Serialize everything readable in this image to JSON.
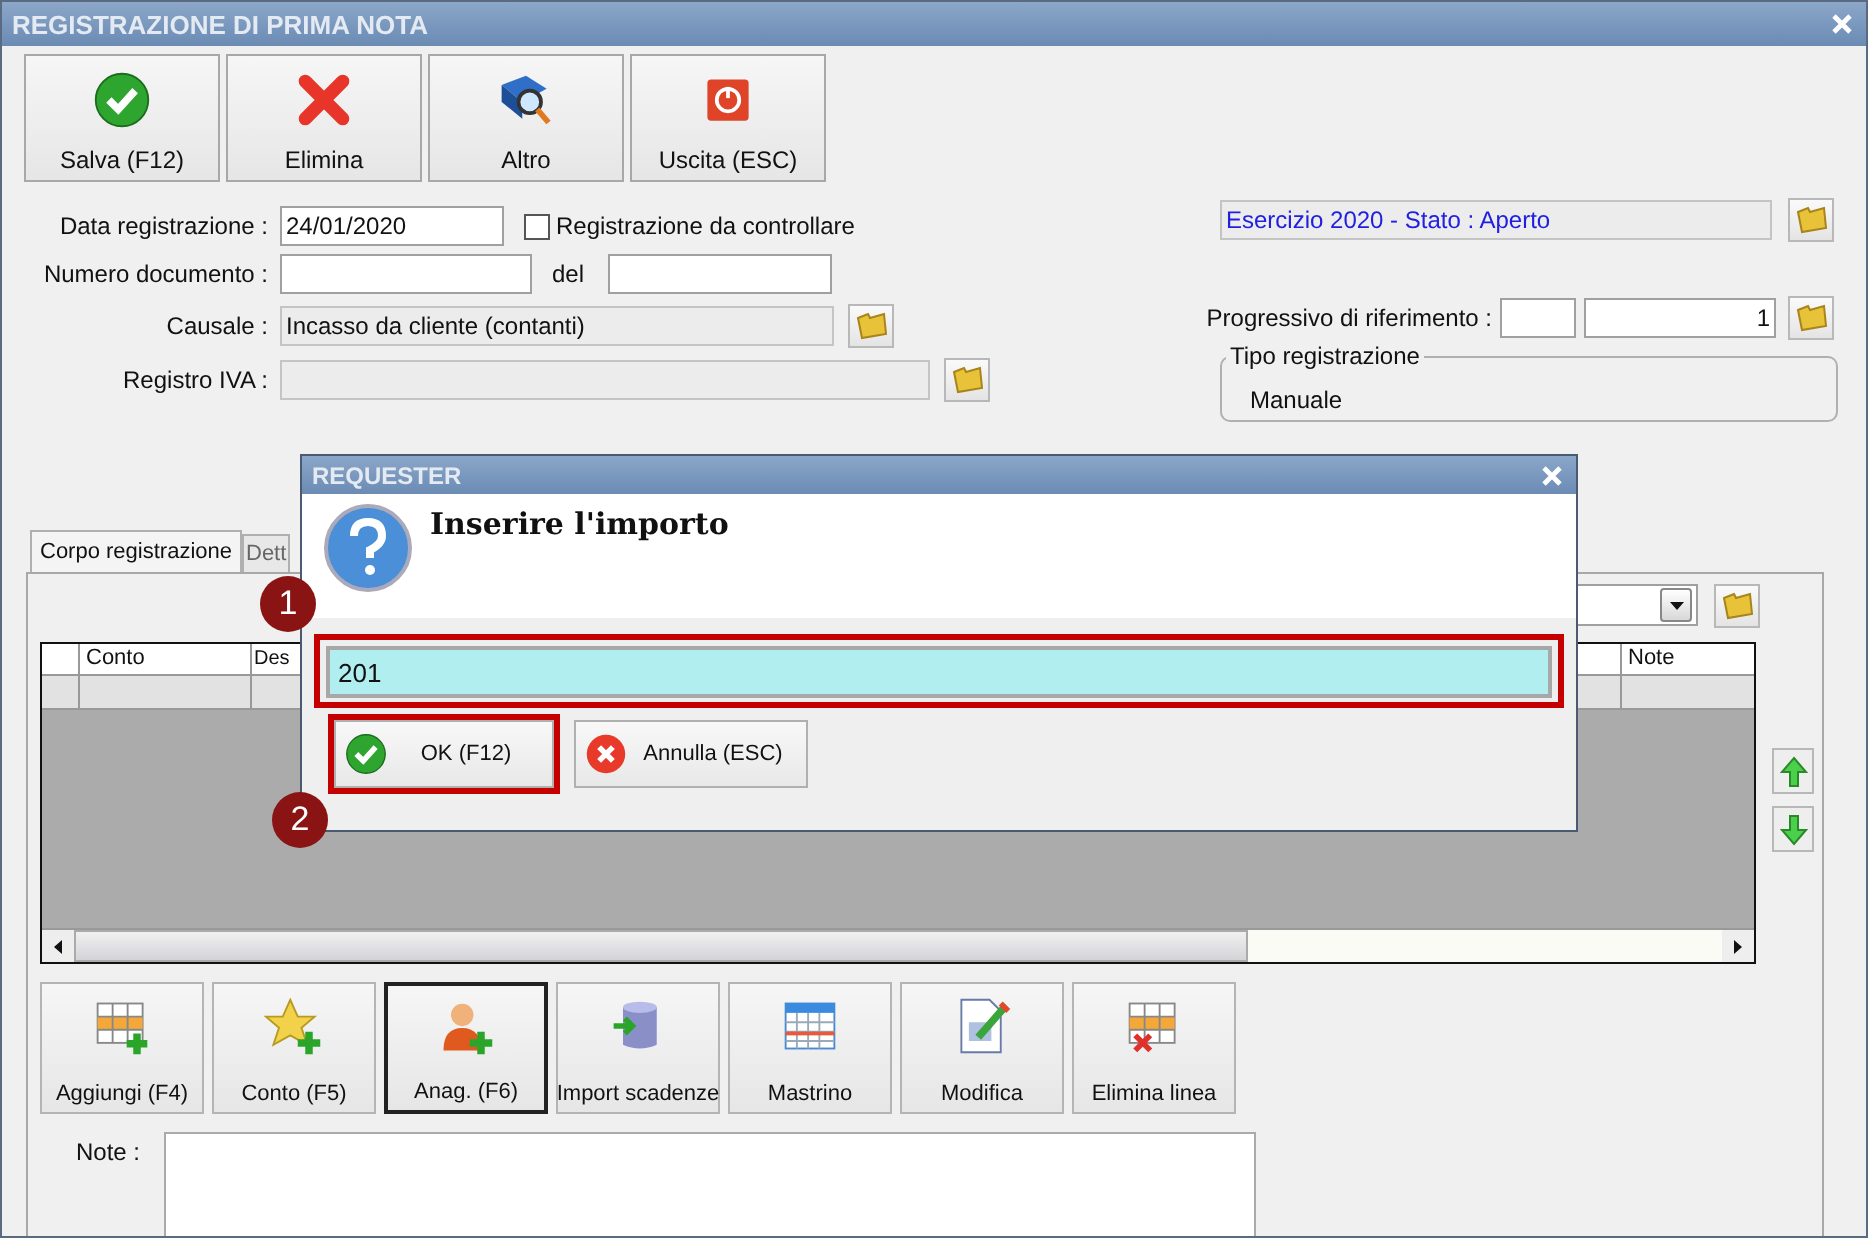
{
  "window": {
    "title": "REGISTRAZIONE DI PRIMA NOTA"
  },
  "toolbar": [
    {
      "label": "Salva (F12)",
      "kind": "check"
    },
    {
      "label": "Elimina",
      "kind": "cross"
    },
    {
      "label": "Altro",
      "kind": "search-book"
    },
    {
      "label": "Uscita (ESC)",
      "kind": "power"
    }
  ],
  "form": {
    "data_registrazione": {
      "label": "Data registrazione :",
      "value": "24/01/2020"
    },
    "da_controllare": {
      "label": "Registrazione da controllare",
      "checked": false
    },
    "numero_documento": {
      "label": "Numero documento :"
    },
    "del": {
      "label": "del"
    },
    "causale": {
      "label": "Causale :",
      "value": "Incasso da cliente (contanti)"
    },
    "registro_iva": {
      "label": "Registro IVA :"
    }
  },
  "esercizio": {
    "value": "Esercizio 2020 - Stato : Aperto"
  },
  "progressivo": {
    "label": "Progressivo di riferimento :",
    "value": "1"
  },
  "tipo_registrazione": {
    "legend": "Tipo registrazione",
    "value": "Manuale"
  },
  "tabs": [
    {
      "label": "Corpo registrazione",
      "selected": true
    },
    {
      "label": "Dett",
      "selected": false
    }
  ],
  "table": {
    "columns": [
      "Conto",
      "Des",
      "Note"
    ]
  },
  "actions": [
    {
      "label": "Aggiungi (F4)",
      "kind": "grid-add",
      "selected": false
    },
    {
      "label": "Conto (F5)",
      "kind": "star-add",
      "selected": false
    },
    {
      "label": "Anag. (F6)",
      "kind": "person-add",
      "selected": true
    },
    {
      "label": "Import scadenze",
      "kind": "database",
      "selected": false
    },
    {
      "label": "Mastrino",
      "kind": "calendar",
      "selected": false
    },
    {
      "label": "Modifica",
      "kind": "document-edit",
      "selected": false
    },
    {
      "label": "Elimina linea",
      "kind": "grid-delete",
      "selected": false
    }
  ],
  "note": {
    "label": "Note :"
  },
  "dialog": {
    "title": "REQUESTER",
    "prompt": "Inserire l'importo",
    "value": "201",
    "highlighted": true,
    "buttons": [
      {
        "label": "OK (F12)",
        "kind": "ok",
        "highlighted": true
      },
      {
        "label": "Annulla (ESC)",
        "kind": "cancel",
        "highlighted": false
      }
    ]
  },
  "callouts": [
    {
      "number": "1"
    },
    {
      "number": "2"
    }
  ]
}
